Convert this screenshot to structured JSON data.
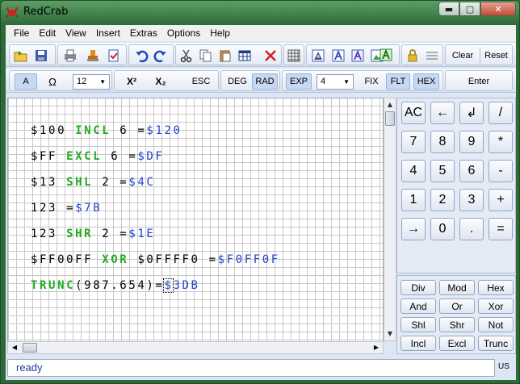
{
  "window": {
    "title": "RedCrab",
    "min_label": "▬",
    "max_label": "▢",
    "close_label": "✕"
  },
  "menu": [
    "File",
    "Edit",
    "View",
    "Insert",
    "Extras",
    "Options",
    "Help"
  ],
  "toolbar1": {
    "clear_label": "Clear",
    "reset_label": "Reset"
  },
  "toolbar2": {
    "font_a": "A",
    "omega": "Ω",
    "font_size": "12",
    "sup": "X²",
    "sub": "X₂",
    "esc": "ESC",
    "deg": "DEG",
    "rad": "RAD",
    "exp": "EXP",
    "precision": "4",
    "fix": "FIX",
    "flt": "FLT",
    "hex": "HEX",
    "enter": "Enter"
  },
  "editor": {
    "lines": [
      [
        {
          "t": "$100 ",
          "c": "op"
        },
        {
          "t": "INCL",
          "c": "kw"
        },
        {
          "t": " 6 =",
          "c": "op"
        },
        {
          "t": "$120",
          "c": "res"
        }
      ],
      [
        {
          "t": "$FF ",
          "c": "op"
        },
        {
          "t": "EXCL",
          "c": "kw"
        },
        {
          "t": " 6 =",
          "c": "op"
        },
        {
          "t": "$DF",
          "c": "res"
        }
      ],
      [
        {
          "t": "$13 ",
          "c": "op"
        },
        {
          "t": "SHL",
          "c": "kw"
        },
        {
          "t": " 2 =",
          "c": "op"
        },
        {
          "t": "$4C",
          "c": "res"
        }
      ],
      [
        {
          "t": "123 =",
          "c": "op"
        },
        {
          "t": "$7B",
          "c": "res"
        }
      ],
      [
        {
          "t": "123 ",
          "c": "op"
        },
        {
          "t": "SHR",
          "c": "kw"
        },
        {
          "t": " 2 =",
          "c": "op"
        },
        {
          "t": "$1E",
          "c": "res"
        }
      ],
      [
        {
          "t": "$FF00FF ",
          "c": "op"
        },
        {
          "t": "XOR",
          "c": "kw"
        },
        {
          "t": " $0FFFF0 =",
          "c": "op"
        },
        {
          "t": "$F0FF0F",
          "c": "res"
        }
      ],
      [
        {
          "t": "TRUNC",
          "c": "kw"
        },
        {
          "t": "(987.654)=",
          "c": "op"
        },
        {
          "t": "$",
          "c": "res cursor"
        },
        {
          "t": "3DB",
          "c": "res"
        }
      ]
    ]
  },
  "keypad": [
    [
      "AC",
      "←",
      "↲",
      "/"
    ],
    [
      "7",
      "8",
      "9",
      "*"
    ],
    [
      "4",
      "5",
      "6",
      "-"
    ],
    [
      "1",
      "2",
      "3",
      "+"
    ],
    [
      "→",
      "0",
      ".",
      "="
    ]
  ],
  "fnpad": [
    [
      "Div",
      "Mod",
      "Hex"
    ],
    [
      "And",
      "Or",
      "Xor"
    ],
    [
      "Shl",
      "Shr",
      "Not"
    ],
    [
      "Incl",
      "Excl",
      "Trunc"
    ]
  ],
  "status": {
    "text": "ready",
    "locale": "US"
  }
}
